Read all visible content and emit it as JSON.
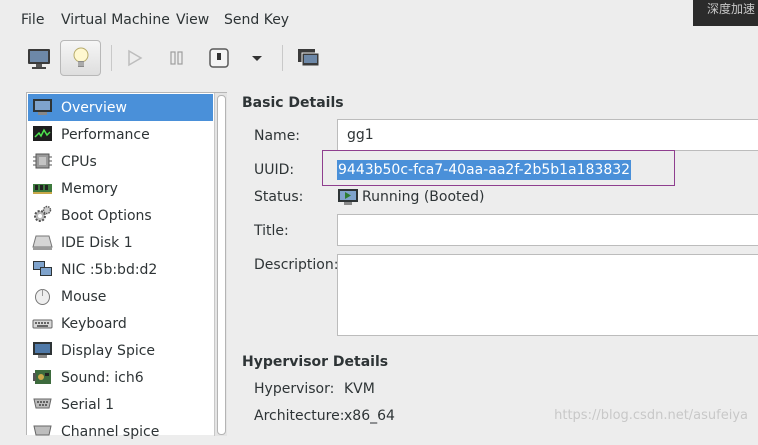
{
  "menubar": {
    "items": [
      "File",
      "Virtual Machine",
      "View",
      "Send Key"
    ],
    "overlay_text": "深度加速"
  },
  "toolbar": {
    "buttons": [
      "console-icon",
      "lightbulb-icon",
      "run-icon",
      "pause-icon",
      "shutdown-icon",
      "dropdown-arrow-icon",
      "screenshot-icon"
    ]
  },
  "sidebar": {
    "items": [
      {
        "label": "Overview",
        "icon": "monitor-icon",
        "selected": true
      },
      {
        "label": "Performance",
        "icon": "performance-graph-icon"
      },
      {
        "label": "CPUs",
        "icon": "cpu-chip-icon"
      },
      {
        "label": "Memory",
        "icon": "memory-module-icon"
      },
      {
        "label": "Boot Options",
        "icon": "gears-icon"
      },
      {
        "label": "IDE Disk 1",
        "icon": "disk-icon"
      },
      {
        "label": "NIC :5b:bd:d2",
        "icon": "network-icon"
      },
      {
        "label": "Mouse",
        "icon": "mouse-icon"
      },
      {
        "label": "Keyboard",
        "icon": "keyboard-icon"
      },
      {
        "label": "Display Spice",
        "icon": "display-icon"
      },
      {
        "label": "Sound: ich6",
        "icon": "sound-card-icon"
      },
      {
        "label": "Serial 1",
        "icon": "serial-port-icon"
      },
      {
        "label": "Channel spice",
        "icon": "channel-icon"
      }
    ]
  },
  "basic_details": {
    "title": "Basic Details",
    "name_label": "Name:",
    "name_value": "gg1",
    "uuid_label": "UUID:",
    "uuid_value": "9443b50c-fca7-40aa-aa2f-2b5b1a183832",
    "status_label": "Status:",
    "status_value": "Running (Booted)",
    "title_label": "Title:",
    "title_value": "",
    "description_label": "Description:",
    "description_value": ""
  },
  "hypervisor_details": {
    "title": "Hypervisor Details",
    "hypervisor_label": "Hypervisor:",
    "hypervisor_value": "KVM",
    "architecture_label": "Architecture:",
    "architecture_value": "x86_64"
  },
  "watermark": "https://blog.csdn.net/asufeiya",
  "colors": {
    "selection": "#4a90d9",
    "uuid_outline": "#8f3f8f"
  }
}
